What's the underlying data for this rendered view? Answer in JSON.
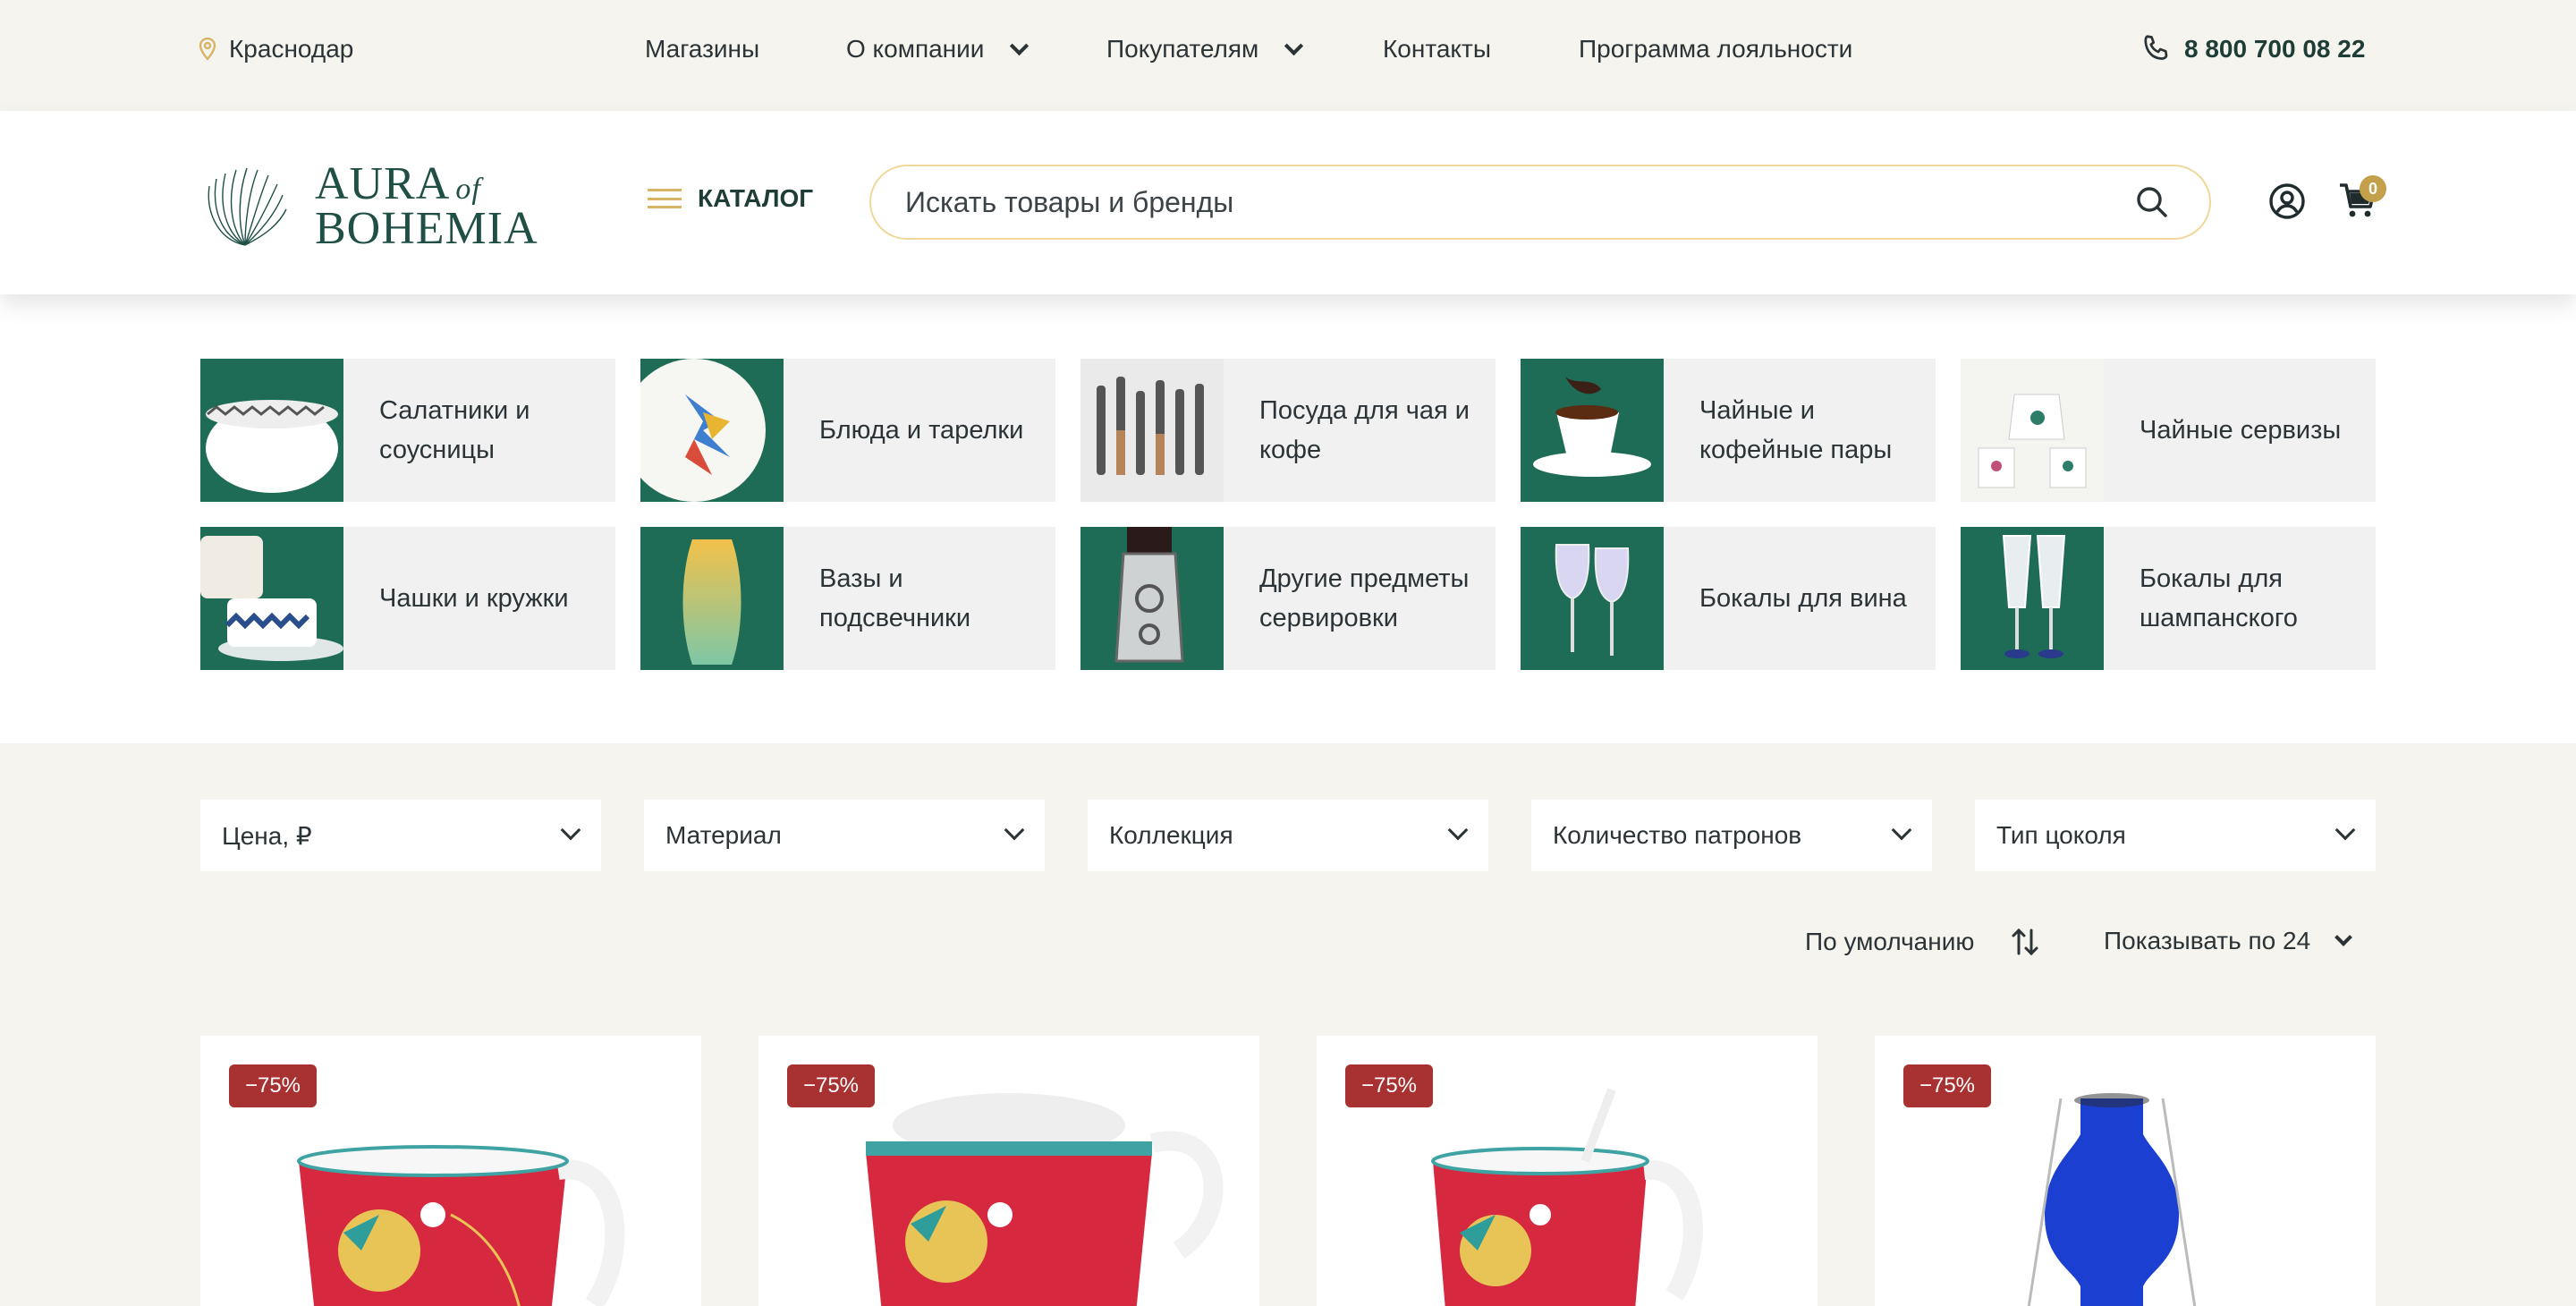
{
  "topbar": {
    "city": "Краснодар",
    "nav": [
      "Магазины",
      "О компании",
      "Покупателям",
      "Контакты",
      "Программа лояльности"
    ],
    "phone": "8 800 700 08 22"
  },
  "header": {
    "logo_line1": "AURA",
    "logo_of": "of",
    "logo_line2": "BOHEMIA",
    "catalog_label": "КАТАЛОГ",
    "search_placeholder": "Искать товары и бренды",
    "cart_count": "0"
  },
  "categories": [
    {
      "label": "Салатники и соусницы"
    },
    {
      "label": "Блюда и тарелки"
    },
    {
      "label": "Посуда для чая и кофе"
    },
    {
      "label": "Чайные и кофейные пары"
    },
    {
      "label": "Чайные сервизы"
    },
    {
      "label": "Чашки и кружки"
    },
    {
      "label": "Вазы и подсвечники"
    },
    {
      "label": "Другие предметы сервировки"
    },
    {
      "label": "Бокалы для вина"
    },
    {
      "label": "Бокалы для шампанского"
    }
  ],
  "filters": [
    "Цена, ₽",
    "Материал",
    "Коллекция",
    "Количество патронов",
    "Тип цоколя"
  ],
  "sort": {
    "order_label": "По умолчанию",
    "per_page_label": "Показывать по 24"
  },
  "products": [
    {
      "discount": "−75%"
    },
    {
      "discount": "−75%"
    },
    {
      "discount": "−75%"
    },
    {
      "discount": "−75%"
    }
  ],
  "colors": {
    "brand_green": "#1f4f45",
    "accent_gold": "#d8b466",
    "discount_red": "#a83232",
    "category_bg": "#1e6b56"
  },
  "icons": [
    "location-pin-icon",
    "chevron-down-icon",
    "phone-icon",
    "menu-icon",
    "search-icon",
    "user-icon",
    "cart-icon",
    "sort-icon"
  ]
}
